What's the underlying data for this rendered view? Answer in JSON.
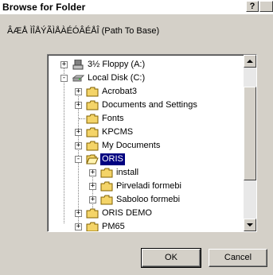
{
  "window": {
    "title": "Browse for Folder",
    "help_label": "?",
    "close_label": "x"
  },
  "prompt": "ÂÆÅ ÌÎÅÝÃÌÅÀÉÓÂÉÅÎ (Path To Base)",
  "tree": {
    "items": [
      {
        "label": "3½ Floppy (A:)",
        "icon": "floppy-drive-icon",
        "expander": "+"
      },
      {
        "label": "Local Disk (C:)",
        "icon": "hard-drive-icon",
        "expander": "-"
      },
      {
        "label": "Acrobat3",
        "icon": "folder-icon",
        "expander": "+"
      },
      {
        "label": "Documents and Settings",
        "icon": "folder-icon",
        "expander": "+"
      },
      {
        "label": "Fonts",
        "icon": "folder-icon",
        "expander": ""
      },
      {
        "label": "KPCMS",
        "icon": "folder-icon",
        "expander": "+"
      },
      {
        "label": "My Documents",
        "icon": "folder-icon",
        "expander": "+"
      },
      {
        "label": "ORIS",
        "icon": "open-folder-icon",
        "expander": "-",
        "selected": true
      },
      {
        "label": "install",
        "icon": "folder-icon",
        "expander": "+"
      },
      {
        "label": "Pirveladi formebi",
        "icon": "folder-icon",
        "expander": "+"
      },
      {
        "label": "Saboloo formebi",
        "icon": "folder-icon",
        "expander": "+"
      },
      {
        "label": "ORIS DEMO",
        "icon": "folder-icon",
        "expander": "+"
      },
      {
        "label": "PM65",
        "icon": "folder-icon",
        "expander": "+"
      }
    ]
  },
  "buttons": {
    "ok": "OK",
    "cancel": "Cancel"
  },
  "colors": {
    "selection": "#000080",
    "folder": "#f4d468",
    "dialog": "#d4d0c8"
  }
}
